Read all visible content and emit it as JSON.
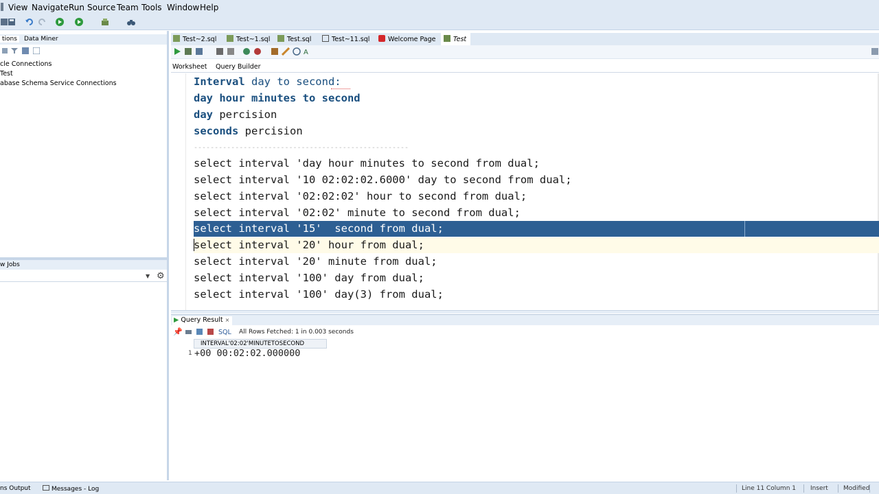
{
  "menu": [
    "View",
    "Navigate",
    "Run",
    "Source",
    "Team",
    "Tools",
    "Window",
    "Help"
  ],
  "left_panel": {
    "tabs": [
      "tions",
      "Data Miner"
    ],
    "tree": [
      "cle Connections",
      "Test",
      "abase Schema Service Connections"
    ],
    "jobs_title": "w Jobs"
  },
  "editor_tabs": [
    "Test~2.sql",
    "Test~1.sql",
    "Test.sql",
    "Test~11.sql",
    "Welcome Page",
    "Test"
  ],
  "worksheet_tabs": [
    "Worksheet",
    "Query Builder"
  ],
  "code_lines": [
    {
      "kw": "Interval",
      "rest": " day to second:"
    },
    {
      "kw": "day hour minutes to second",
      "rest": ""
    },
    {
      "kw": "day",
      "rest": " percision"
    },
    {
      "kw": "seconds",
      "rest": " percision"
    },
    {
      "kw": "",
      "rest": "----------------------------------------------------"
    },
    {
      "kw": "",
      "rest": "select interval 'day hour minutes to second from dual;"
    },
    {
      "kw": "",
      "rest": "select interval '10 02:02:02.6000' day to second from dual;"
    },
    {
      "kw": "",
      "rest": "select interval '02:02:02' hour to second from dual;"
    },
    {
      "kw": "",
      "rest": "select interval '02:02' minute to second from dual;"
    },
    {
      "kw": "",
      "rest": "select interval '15'  second from dual;"
    },
    {
      "kw": "",
      "rest": "select interval '20' hour from dual;"
    },
    {
      "kw": "",
      "rest": "select interval '20' minute from dual;"
    },
    {
      "kw": "",
      "rest": "select interval '100' day from dual;"
    },
    {
      "kw": "",
      "rest": "select interval '100' day(3) from dual;"
    }
  ],
  "result": {
    "tab": "Query Result",
    "sql_label": "SQL",
    "status": "All Rows Fetched: 1 in 0.003 seconds",
    "column": "INTERVAL'02:02'MINUTETOSECOND",
    "row_num": "1",
    "value": "+00 00:02:02.000000"
  },
  "statusbar": {
    "left1": "ns Output",
    "left2": "Messages - Log",
    "pos": "Line 11 Column 1",
    "mode": "Insert",
    "state": "Modified"
  },
  "colors": {
    "chrome": "#dfe9f4",
    "selection": "#2d5f93",
    "keyword": "#1a4f7f"
  }
}
